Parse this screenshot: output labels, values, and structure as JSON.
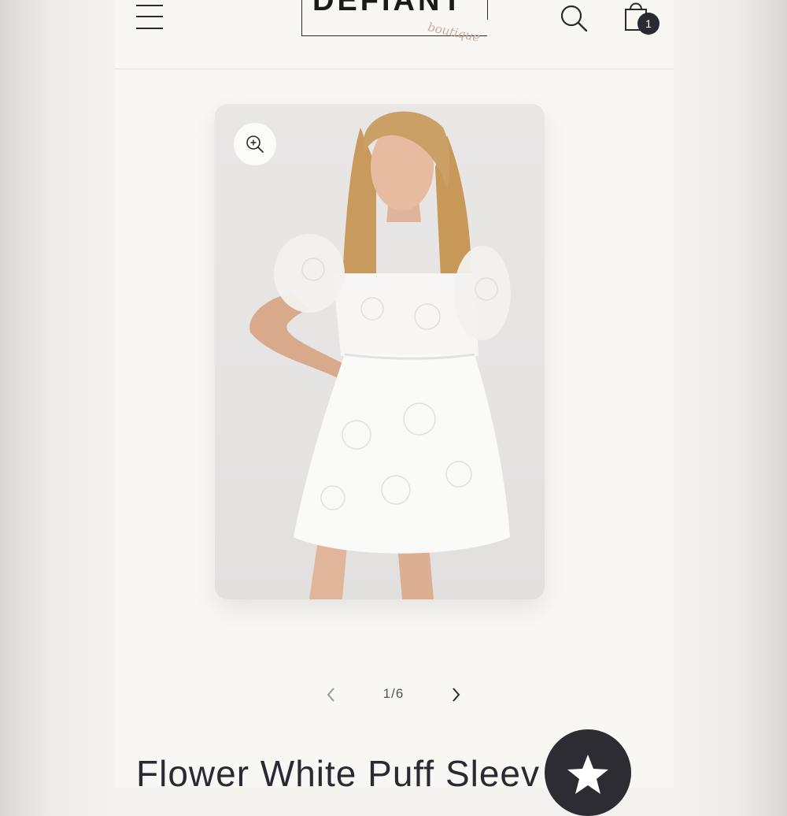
{
  "header": {
    "logo_text": "DEFIANT",
    "logo_script": "boutique",
    "cart_count": "1"
  },
  "icons": {
    "menu": "hamburger-menu-icon",
    "search": "search-icon",
    "cart": "shopping-bag-icon",
    "zoom": "zoom-in-icon",
    "prev": "chevron-left-icon",
    "next": "chevron-right-icon",
    "reviews": "star-icon"
  },
  "gallery": {
    "pager": "1/6"
  },
  "product": {
    "title": "Flower White Puff Sleev"
  },
  "colors": {
    "accent": "#2c2c32",
    "background": "#f8f7f4"
  }
}
